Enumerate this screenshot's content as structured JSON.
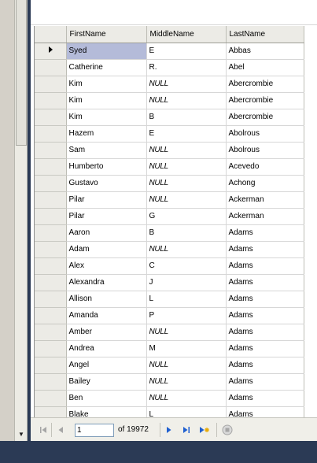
{
  "grid": {
    "columns": [
      "FirstName",
      "MiddleName",
      "LastName"
    ],
    "selected_row": 0,
    "rows": [
      [
        "Syed",
        "E",
        "Abbas"
      ],
      [
        "Catherine",
        "R.",
        "Abel"
      ],
      [
        "Kim",
        "NULL",
        "Abercrombie"
      ],
      [
        "Kim",
        "NULL",
        "Abercrombie"
      ],
      [
        "Kim",
        "B",
        "Abercrombie"
      ],
      [
        "Hazem",
        "E",
        "Abolrous"
      ],
      [
        "Sam",
        "NULL",
        "Abolrous"
      ],
      [
        "Humberto",
        "NULL",
        "Acevedo"
      ],
      [
        "Gustavo",
        "NULL",
        "Achong"
      ],
      [
        "Pilar",
        "NULL",
        "Ackerman"
      ],
      [
        "Pilar",
        "G",
        "Ackerman"
      ],
      [
        "Aaron",
        "B",
        "Adams"
      ],
      [
        "Adam",
        "NULL",
        "Adams"
      ],
      [
        "Alex",
        "C",
        "Adams"
      ],
      [
        "Alexandra",
        "J",
        "Adams"
      ],
      [
        "Allison",
        "L",
        "Adams"
      ],
      [
        "Amanda",
        "P",
        "Adams"
      ],
      [
        "Amber",
        "NULL",
        "Adams"
      ],
      [
        "Andrea",
        "M",
        "Adams"
      ],
      [
        "Angel",
        "NULL",
        "Adams"
      ],
      [
        "Bailey",
        "NULL",
        "Adams"
      ],
      [
        "Ben",
        "NULL",
        "Adams"
      ],
      [
        "Blake",
        "L",
        "Adams"
      ]
    ]
  },
  "pager": {
    "current_page": "1",
    "of_label": "of 19972"
  },
  "icons": {
    "first": "first-record-icon",
    "prev": "previous-record-icon",
    "next": "next-record-icon",
    "last": "last-record-icon",
    "new": "new-record-icon",
    "stop": "stop-icon",
    "row_pointer": "row-pointer-icon"
  },
  "colors": {
    "selected_cell": "#b4bbd9",
    "header_bg": "#ecebe6",
    "nav_blue": "#1f5fd0",
    "disabled_gray": "#a6a6a6"
  }
}
